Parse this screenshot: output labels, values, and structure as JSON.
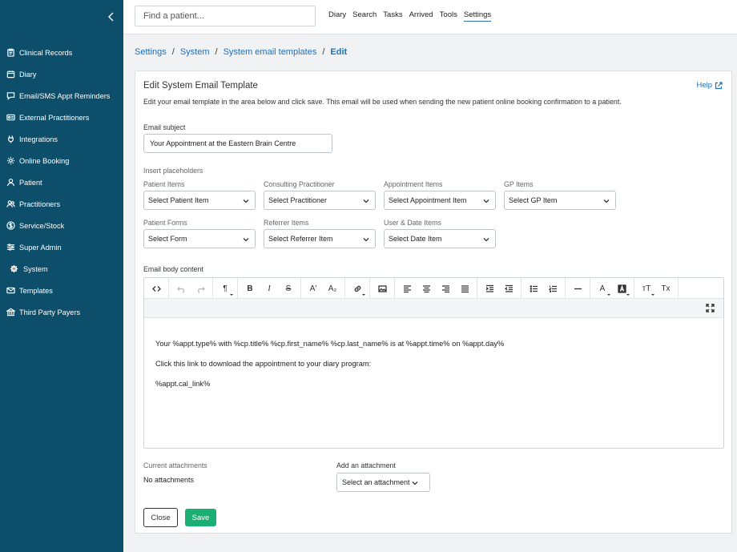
{
  "sidebar": {
    "items": [
      {
        "label": "Clinical Records",
        "icon": "clipboard-icon"
      },
      {
        "label": "Diary",
        "icon": "calendar-icon"
      },
      {
        "label": "Email/SMS Appt Reminders",
        "icon": "chat-icon"
      },
      {
        "label": "External Practitioners",
        "icon": "id-card-icon"
      },
      {
        "label": "Integrations",
        "icon": "plug-icon"
      },
      {
        "label": "Online Booking",
        "icon": "sun-icon"
      },
      {
        "label": "Patient",
        "icon": "user-icon"
      },
      {
        "label": "Practitioners",
        "icon": "users-icon"
      },
      {
        "label": "Service/Stock",
        "icon": "dollar-icon"
      },
      {
        "label": "Super Admin",
        "icon": "sliders-icon"
      },
      {
        "label": "System",
        "icon": "gear-icon"
      },
      {
        "label": "Templates",
        "icon": "mail-icon"
      },
      {
        "label": "Third Party Payers",
        "icon": "bank-icon"
      }
    ]
  },
  "topbar": {
    "search_placeholder": "Find a patient...",
    "nav": [
      "Diary",
      "Search",
      "Tasks",
      "Arrived",
      "Tools",
      "Settings"
    ],
    "active_nav": "Settings"
  },
  "breadcrumb": {
    "items": [
      "Settings",
      "System",
      "System email templates"
    ],
    "current": "Edit"
  },
  "card": {
    "title": "Edit System Email Template",
    "help": "Help",
    "description": "Edit your email template in the area below and click save. This email will be used when sending the new patient online booking confirmation to a patient.",
    "subject_label": "Email subject",
    "subject_value": "Your Appointment at the Eastern Brain Centre",
    "placeholders_label": "Insert placeholders",
    "placeholders": {
      "patient_items": {
        "label": "Patient Items",
        "value": "Select Patient Item"
      },
      "consulting_practitioner": {
        "label": "Consulting Practitioner",
        "value": "Select Practitioner"
      },
      "appointment_items": {
        "label": "Appointment Items",
        "value": "Select Appointment Item"
      },
      "gp_items": {
        "label": "GP Items",
        "value": "Select GP Item"
      },
      "patient_forms": {
        "label": "Patient Forms",
        "value": "Select Form"
      },
      "referrer_items": {
        "label": "Referrer Items",
        "value": "Select Referrer Item"
      },
      "user_date_items": {
        "label": "User & Date Items",
        "value": "Select Date Item"
      }
    },
    "body_label": "Email body content",
    "body_lines": [
      "Your %appt.type% with %cp.title% %cp.first_name% %cp.last_name% is at %appt.time% on %appt.day%",
      "Click this link to download the appointment to your diary program:",
      "%appt.cal_link%"
    ],
    "current_attachments_label": "Current attachments",
    "current_attachments_value": "No attachments",
    "add_attachment_label": "Add an attachment",
    "add_attachment_value": "Select an attachment",
    "close_label": "Close",
    "save_label": "Save"
  },
  "toolbar": {
    "code_view": "<>",
    "paragraph": "¶",
    "bold": "B",
    "italic": "I",
    "strike": "S",
    "superscript": "A'",
    "subscript": "A₂",
    "font_color": "A",
    "text_size": "тT",
    "clear_format": "Tx"
  },
  "colors": {
    "sidebar_bg": "#0d4e6b",
    "link": "#1f6fb5",
    "save_button": "#1aaf73"
  }
}
